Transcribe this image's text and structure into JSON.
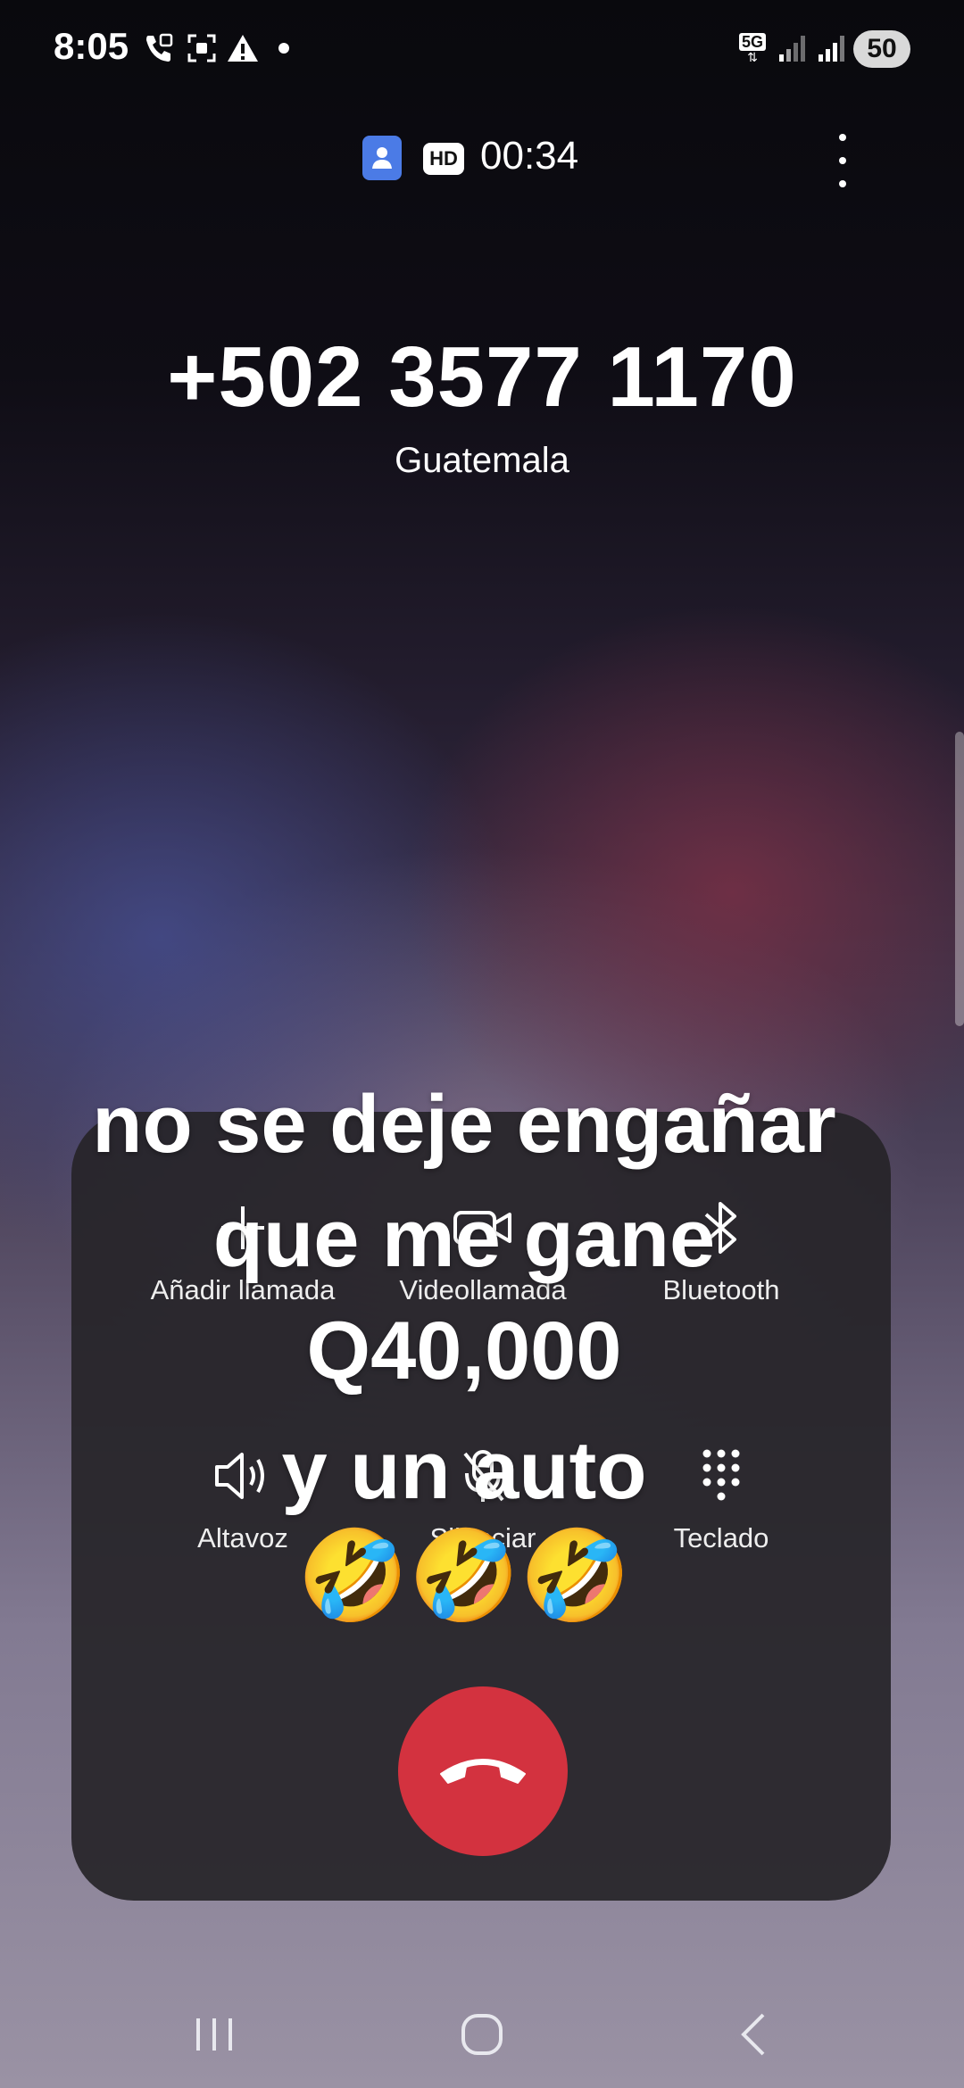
{
  "status_bar": {
    "time": "8:05",
    "network": "5G",
    "battery": "50"
  },
  "call": {
    "hd_label": "HD",
    "timer": "00:34",
    "number": "+502 3577 1170",
    "location": "Guatemala"
  },
  "controls": [
    {
      "label": "Añadir llamada",
      "icon": "plus-icon"
    },
    {
      "label": "Videollamada",
      "icon": "video-icon"
    },
    {
      "label": "Bluetooth",
      "icon": "bluetooth-icon"
    },
    {
      "label": "Altavoz",
      "icon": "speaker-icon"
    },
    {
      "label": "Silenciar",
      "icon": "mic-off-icon"
    },
    {
      "label": "Teclado",
      "icon": "keypad-icon"
    }
  ],
  "overlay_caption": {
    "line1": "no se deje engañar",
    "line2": "que me gane",
    "line3": "Q40,000",
    "line4": "y un auto",
    "emojis": "🤣🤣🤣"
  },
  "colors": {
    "end_call": "#d3323f",
    "contact_icon": "#4b7be6"
  }
}
